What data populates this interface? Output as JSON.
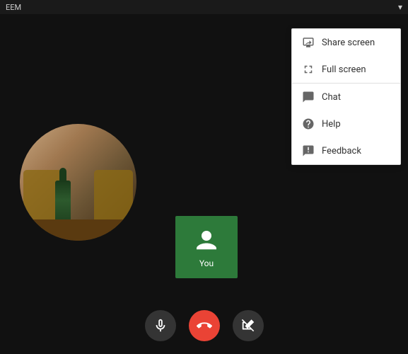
{
  "titleBar": {
    "appName": "EEM",
    "iconLabel": "signal-icon"
  },
  "menu": {
    "items": [
      {
        "id": "share-screen",
        "label": "Share screen",
        "icon": "share-screen-icon"
      },
      {
        "id": "full-screen",
        "label": "Full screen",
        "icon": "fullscreen-icon"
      },
      {
        "id": "chat",
        "label": "Chat",
        "icon": "chat-icon"
      },
      {
        "id": "help",
        "label": "Help",
        "icon": "help-icon"
      },
      {
        "id": "feedback",
        "label": "Feedback",
        "icon": "feedback-icon"
      }
    ]
  },
  "remoteUser": {
    "label": "You"
  },
  "controls": {
    "mic": "mic-button",
    "hangup": "hangup-button",
    "videoOff": "video-off-button"
  }
}
